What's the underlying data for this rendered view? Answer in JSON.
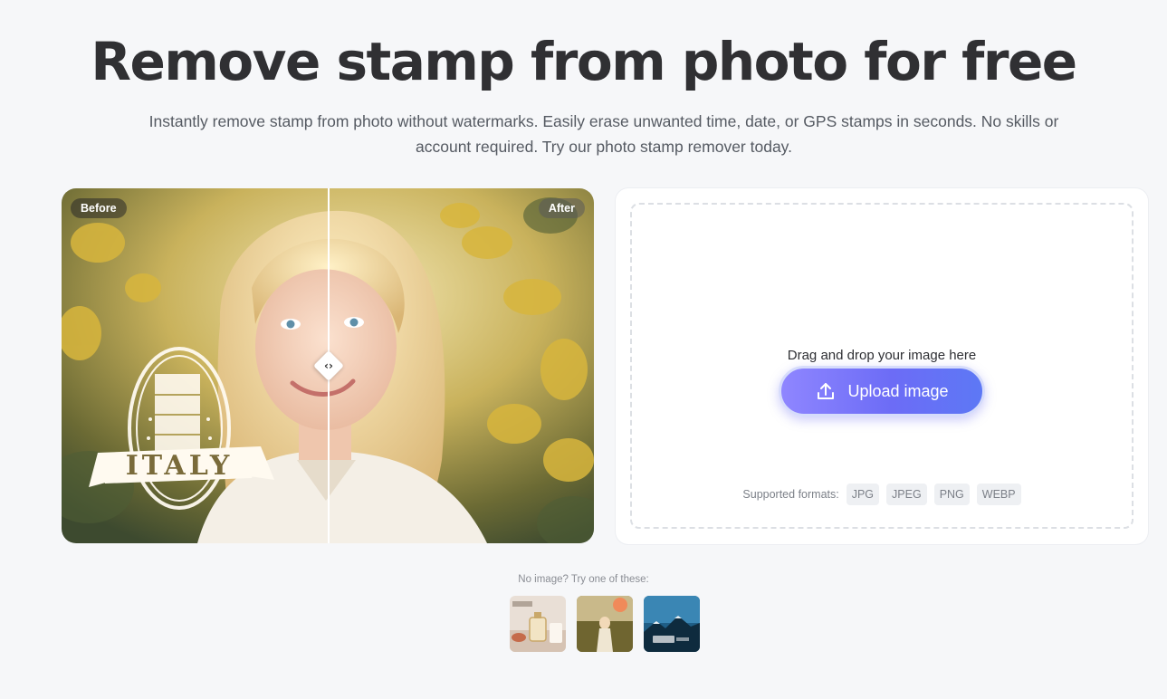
{
  "header": {
    "title": "Remove stamp from photo for free",
    "subtitle": "Instantly remove stamp from photo without watermarks. Easily erase unwanted time, date, or GPS stamps in seconds. No skills or account required. Try our photo stamp remover today."
  },
  "compare": {
    "before_label": "Before",
    "after_label": "After",
    "stamp_text": "ITALY",
    "handle_glyph": "‹›"
  },
  "upload": {
    "drop_text": "Drag and drop your image here",
    "button_label": "Upload image",
    "formats_label": "Supported formats:",
    "formats": [
      "JPG",
      "JPEG",
      "PNG",
      "WEBP"
    ]
  },
  "samples": {
    "label": "No image? Try one of these:"
  }
}
